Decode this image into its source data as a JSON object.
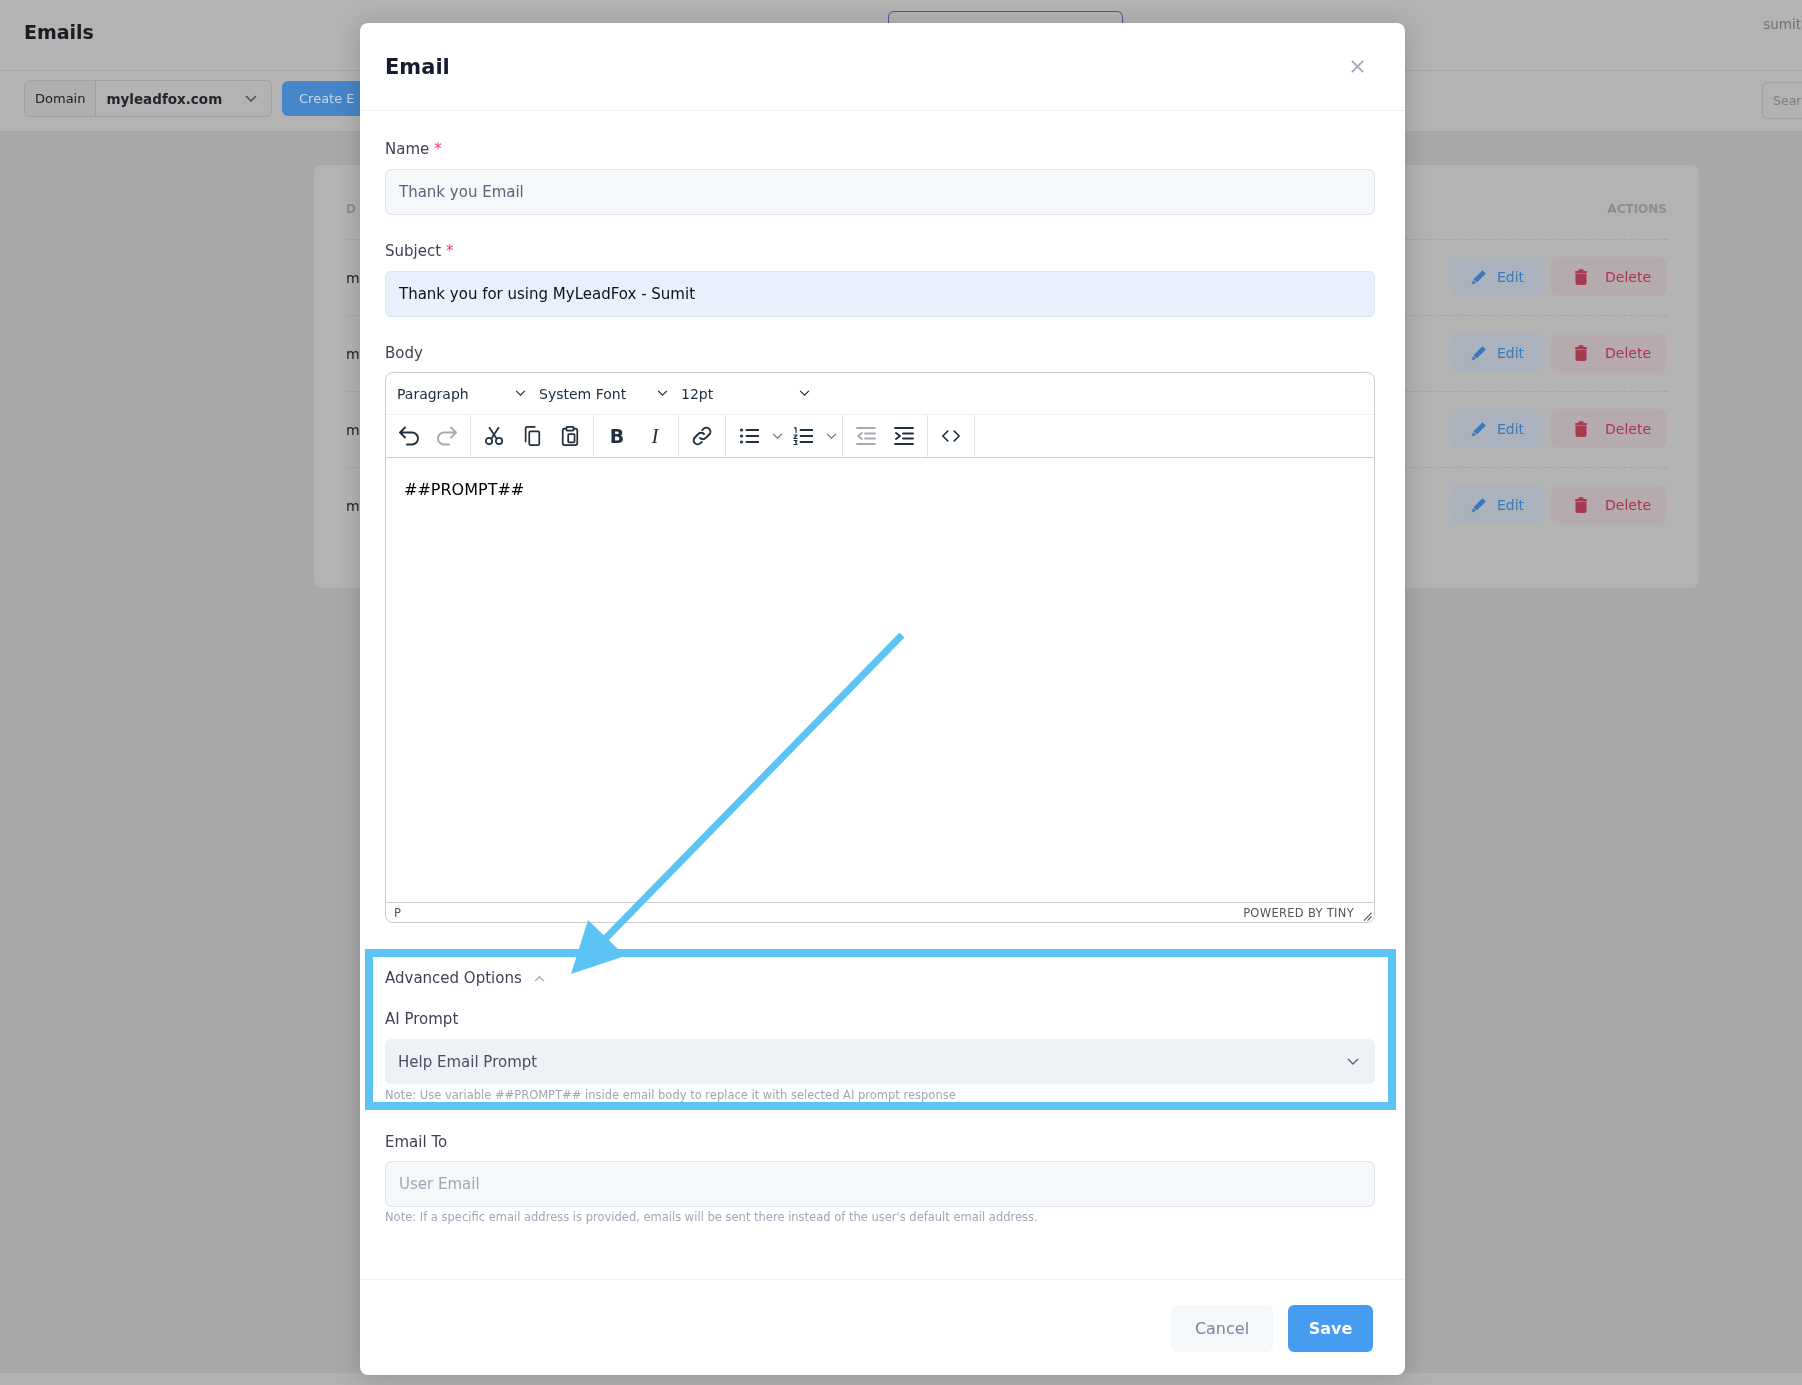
{
  "background": {
    "title": "Emails",
    "user": "sumit",
    "domain_filter": {
      "label": "Domain",
      "value": "myleadfox.com"
    },
    "create_button": "Create E",
    "search": {
      "placeholder": "Sear"
    },
    "table": {
      "columns": [
        "D",
        "ACTIONS"
      ],
      "rows": [
        {
          "column_1": "m",
          "actions": [
            {
              "kind": "edit",
              "label": "Edit"
            },
            {
              "kind": "delete",
              "label": "Delete"
            }
          ]
        },
        {
          "column_1": "m",
          "actions": [
            {
              "kind": "edit",
              "label": "Edit"
            },
            {
              "kind": "delete",
              "label": "Delete"
            }
          ]
        },
        {
          "column_1": "m",
          "actions": [
            {
              "kind": "edit",
              "label": "Edit"
            },
            {
              "kind": "delete",
              "label": "Delete"
            }
          ]
        },
        {
          "column_1": "m",
          "actions": [
            {
              "kind": "edit",
              "label": "Edit"
            },
            {
              "kind": "delete",
              "label": "Delete"
            }
          ]
        }
      ]
    }
  },
  "modal": {
    "title": "Email",
    "name": {
      "label": "Name",
      "required_mark": "*",
      "value": "Thank you Email"
    },
    "subject": {
      "label": "Subject",
      "required_mark": "*",
      "value": "Thank you for using MyLeadFox - Sumit",
      "autofilled": true
    },
    "body": {
      "label": "Body",
      "menus": [
        {
          "label": "Paragraph"
        },
        {
          "label": "System Font"
        },
        {
          "label": "12pt"
        }
      ],
      "toolbar": [
        {
          "tools": [
            {
              "kind": "undo",
              "disabled": false
            },
            {
              "kind": "redo",
              "disabled": true
            }
          ]
        },
        {
          "tools": [
            {
              "kind": "cut",
              "disabled": false
            },
            {
              "kind": "copy",
              "disabled": false
            },
            {
              "kind": "paste",
              "disabled": false
            }
          ]
        },
        {
          "tools": [
            {
              "kind": "bold",
              "glyph": "B",
              "disabled": false
            },
            {
              "kind": "italic",
              "glyph": "I",
              "disabled": false
            }
          ]
        },
        {
          "tools": [
            {
              "kind": "link",
              "disabled": false
            }
          ]
        },
        {
          "tools": [
            {
              "kind": "bullet-list",
              "disabled": false
            },
            {
              "kind": "numbered-list",
              "disabled": false
            }
          ]
        },
        {
          "tools": [
            {
              "kind": "outdent",
              "disabled": true
            },
            {
              "kind": "indent",
              "disabled": false
            }
          ]
        },
        {
          "tools": [
            {
              "kind": "code",
              "disabled": false
            }
          ]
        }
      ],
      "content": "##PROMPT##",
      "element_path": "P",
      "branding": "POWERED BY TINY"
    },
    "advanced": {
      "label": "Advanced Options",
      "expanded": true,
      "ai_prompt": {
        "label": "AI Prompt",
        "value": "Help Email Prompt",
        "note": "Note: Use variable ##PROMPT## inside email body to replace it with selected AI prompt response"
      }
    },
    "email_to": {
      "label": "Email To",
      "placeholder": "User Email",
      "note": "Note: If a specific email address is provided, emails will be sent there instead of the user's default email address."
    },
    "buttons": [
      {
        "kind": "secondary",
        "label": "Cancel"
      },
      {
        "kind": "primary",
        "label": "Save"
      }
    ]
  },
  "annotation": {
    "arrow": true,
    "highlight_frame": true
  }
}
